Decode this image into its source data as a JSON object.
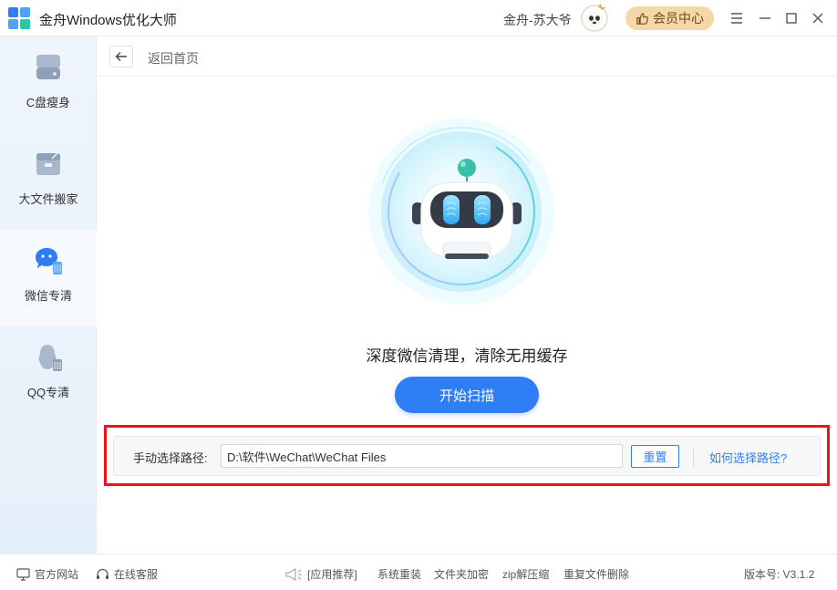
{
  "app": {
    "title": "金舟Windows优化大师",
    "username": "金舟-苏大爷",
    "vip_label": "会员中心"
  },
  "sidebar": {
    "items": [
      {
        "label": "C盘瘦身",
        "icon": "disk-icon"
      },
      {
        "label": "大文件搬家",
        "icon": "box-icon"
      },
      {
        "label": "微信专清",
        "icon": "wechat-clean-icon"
      },
      {
        "label": "QQ专清",
        "icon": "qq-clean-icon"
      }
    ],
    "active_index": 2
  },
  "header": {
    "back_label": "返回首页"
  },
  "main": {
    "headline": "深度微信清理，清除无用缓存",
    "scan_button": "开始扫描",
    "path": {
      "label": "手动选择路径:",
      "value": "D:\\软件\\WeChat\\WeChat Files",
      "reset_button": "重置",
      "help_link": "如何选择路径?"
    }
  },
  "footer": {
    "official_site": "官方网站",
    "online_service": "在线客服",
    "recommend": "[应用推荐]",
    "links": [
      "系统重装",
      "文件夹加密",
      "zip解压缩",
      "重复文件删除"
    ],
    "version": "版本号: V3.1.2"
  },
  "colors": {
    "accent": "#2f7ef5",
    "vip": "#f5d7a8",
    "highlight": "#e81515",
    "sidebar_bg": "#eaf3fb"
  }
}
